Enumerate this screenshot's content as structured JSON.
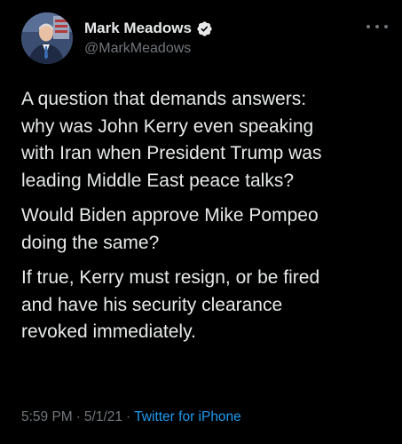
{
  "author": {
    "display_name": "Mark Meadows",
    "handle": "@MarkMeadows",
    "verified_icon": "verified-badge-icon",
    "avatar_icon": "profile-photo"
  },
  "menu": {
    "icon": "more-options-icon"
  },
  "tweet": {
    "paragraphs": [
      {
        "lines": [
          "A question that demands answers:",
          "why was John Kerry even speaking",
          "with Iran when President Trump was",
          "leading Middle East peace talks?"
        ]
      },
      {
        "lines": [
          "Would Biden approve Mike Pompeo",
          "doing the same?"
        ]
      },
      {
        "lines": [
          "If true, Kerry must resign, or be fired",
          "and have his security clearance",
          "revoked immediately."
        ]
      }
    ]
  },
  "meta": {
    "time": "5:59 PM",
    "separator": "·",
    "date": "5/1/21",
    "source": "Twitter for iPhone"
  },
  "colors": {
    "background": "#000000",
    "text_primary": "#e7e9ea",
    "text_secondary": "#71767b",
    "link": "#1d9bf0"
  }
}
